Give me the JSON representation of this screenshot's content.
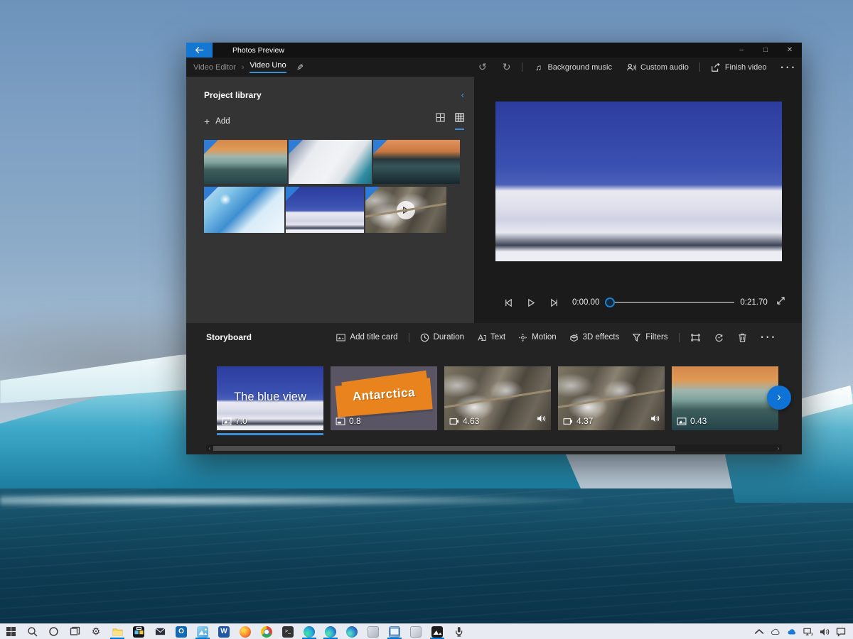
{
  "titlebar": {
    "title": "Photos Preview",
    "controls": {
      "minimize": "–",
      "maximize": "□",
      "close": "✕"
    }
  },
  "breadcrumb": {
    "parent": "Video Editor",
    "separator": "›",
    "current": "Video Uno",
    "edit_icon": "✎"
  },
  "toolbar": {
    "undo_icon": "↺",
    "redo_icon": "↻",
    "background_music": "Background music",
    "custom_audio": "Custom audio",
    "finish_video": "Finish video",
    "more": "• • •"
  },
  "library": {
    "title": "Project library",
    "collapse_icon": "‹",
    "add_label": "Add",
    "add_plus": "+",
    "view_icons": [
      "grid-large-icon",
      "grid-small-icon"
    ],
    "active_view": "grid-small",
    "thumbnails": [
      {
        "name": "iceberg-sunset-teal",
        "type": "image"
      },
      {
        "name": "ice-wall-closeup",
        "type": "image"
      },
      {
        "name": "iceberg-sunset-dark",
        "type": "image"
      },
      {
        "name": "blue-ice-slope",
        "type": "image"
      },
      {
        "name": "snowy-mountain",
        "type": "image"
      },
      {
        "name": "waterfall-rocks",
        "type": "video"
      }
    ]
  },
  "preview": {
    "scene": "snowy-mountain-blue-sky",
    "current_time": "0:00.00",
    "total_time": "0:21.70",
    "progress_percent": 0
  },
  "storyboard": {
    "title": "Storyboard",
    "toolbar": {
      "items": [
        {
          "icon": "title-card-icon",
          "label": "Add title card"
        },
        {
          "icon": "clock-icon",
          "label": "Duration"
        },
        {
          "icon": "text-icon",
          "label": "Text"
        },
        {
          "icon": "motion-icon",
          "label": "Motion"
        },
        {
          "icon": "3d-effects-icon",
          "label": "3D effects"
        },
        {
          "icon": "filters-icon",
          "label": "Filters"
        }
      ],
      "icon_buttons": [
        "resize-frame-icon",
        "rotate-icon",
        "delete-icon",
        "more-icon"
      ],
      "more": "• • •"
    },
    "clips": [
      {
        "title": "The blue view",
        "duration": "7.0",
        "type": "image",
        "selected": true
      },
      {
        "title": "Antarctica",
        "duration": "0.8",
        "type": "title-card",
        "selected": false
      },
      {
        "title": "",
        "duration": "4.63",
        "type": "video",
        "selected": false
      },
      {
        "title": "",
        "duration": "4.37",
        "type": "video",
        "selected": false
      },
      {
        "title": "",
        "duration": "0.43",
        "type": "image",
        "selected": false
      }
    ],
    "next_icon": "›",
    "scroll_left_icon": "‹",
    "scroll_right_icon": "›"
  },
  "taskbar": {
    "items": [
      "start",
      "search",
      "cortana",
      "task-view",
      "settings",
      "file-explorer",
      "store",
      "mail",
      "outlook",
      "photos",
      "word",
      "firefox",
      "chrome",
      "terminal",
      "edge",
      "edge-beta",
      "edge-dev",
      "app-gray-1",
      "app-window",
      "app-gray-2",
      "photos-legacy",
      "audio-recorder"
    ],
    "open_apps": [
      "file-explorer",
      "photos",
      "edge",
      "edge-beta",
      "app-window",
      "photos-legacy"
    ],
    "tray": [
      "hidden-icons-chevron",
      "onedrive",
      "onedrive-sync",
      "network",
      "volume",
      "action-center"
    ],
    "settings_glyph": "⚙",
    "word_glyph": "W",
    "outlook_glyph": "O",
    "terminal_glyph": ">_"
  },
  "colors": {
    "accent_blue": "#0078d7",
    "selection_underline": "#3f8fd6",
    "window_bg": "#1b1b1b",
    "library_bg": "#343434",
    "storyboard_bg": "#232323",
    "titlebar_bg": "#121212",
    "taskbar_bg": "#e8ebf1",
    "title_card_orange": "#e8831d"
  }
}
